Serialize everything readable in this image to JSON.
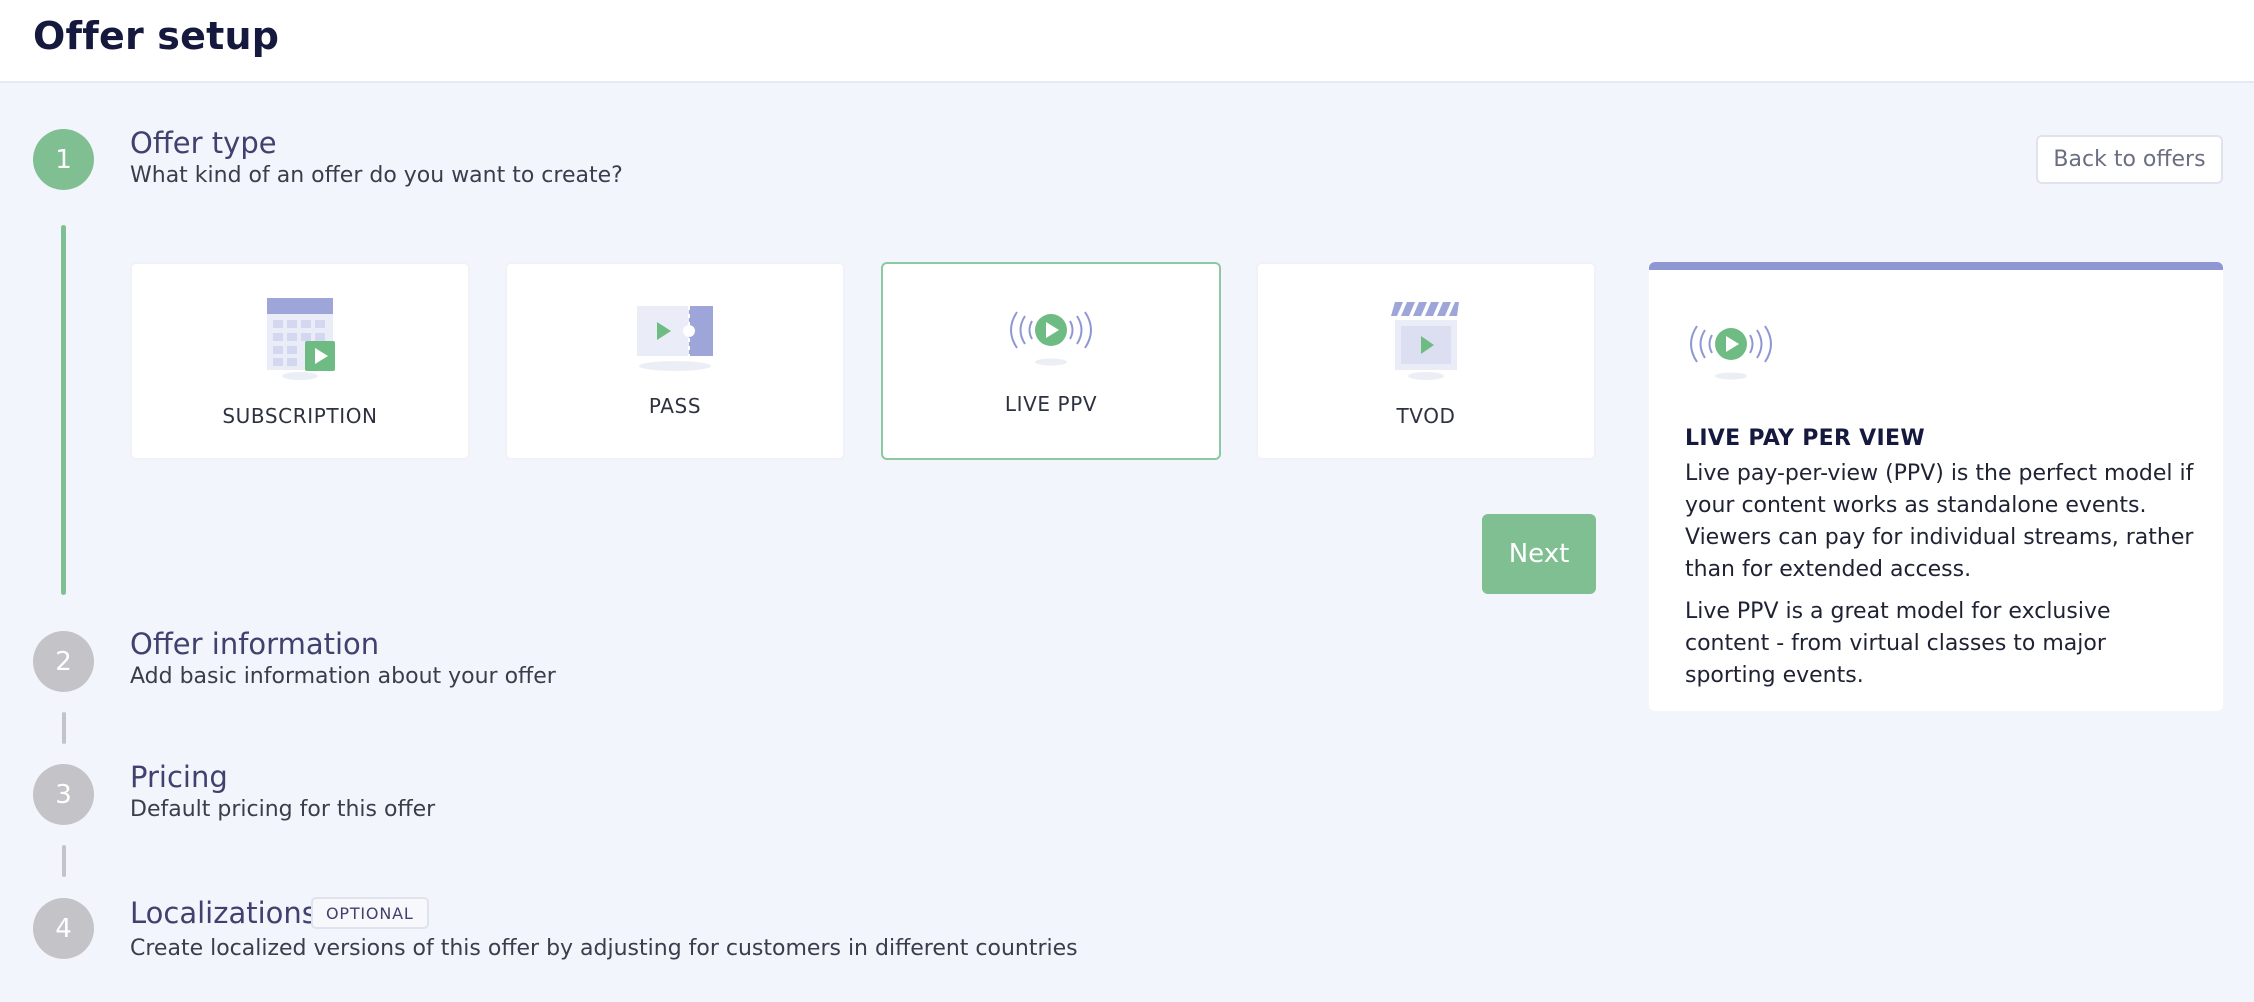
{
  "header": {
    "title": "Offer setup"
  },
  "back_button": "Back to offers",
  "steps": [
    {
      "number": "1",
      "title": "Offer type",
      "subtitle": "What kind of an offer do you want to create?"
    },
    {
      "number": "2",
      "title": "Offer information",
      "subtitle": "Add basic information about your offer"
    },
    {
      "number": "3",
      "title": "Pricing",
      "subtitle": "Default pricing for this offer"
    },
    {
      "number": "4",
      "title": "Localizations",
      "subtitle": "Create localized versions of this offer by adjusting for customers in different countries",
      "badge": "OPTIONAL"
    }
  ],
  "offer_types": [
    {
      "label": "SUBSCRIPTION",
      "icon": "calendar-play-icon"
    },
    {
      "label": "PASS",
      "icon": "ticket-play-icon"
    },
    {
      "label": "LIVE PPV",
      "icon": "live-broadcast-icon",
      "selected": true
    },
    {
      "label": "TVOD",
      "icon": "clapperboard-icon"
    }
  ],
  "next_button": "Next",
  "info_panel": {
    "icon": "live-broadcast-icon",
    "title": "LIVE PAY PER VIEW",
    "paragraph1": "Live pay-per-view (PPV) is the perfect model if your content works as standalone events. Viewers can pay for individual streams, rather than for extended access.",
    "paragraph2": "Live PPV is a great model for exclusive content - from virtual classes to major sporting events."
  },
  "colors": {
    "accent_green": "#7fbf92",
    "accent_purple": "#8f97d3",
    "inactive_grey": "#c4c4c8",
    "title_navy": "#14193d",
    "step_title": "#40416e",
    "background": "#f2f5fc"
  }
}
